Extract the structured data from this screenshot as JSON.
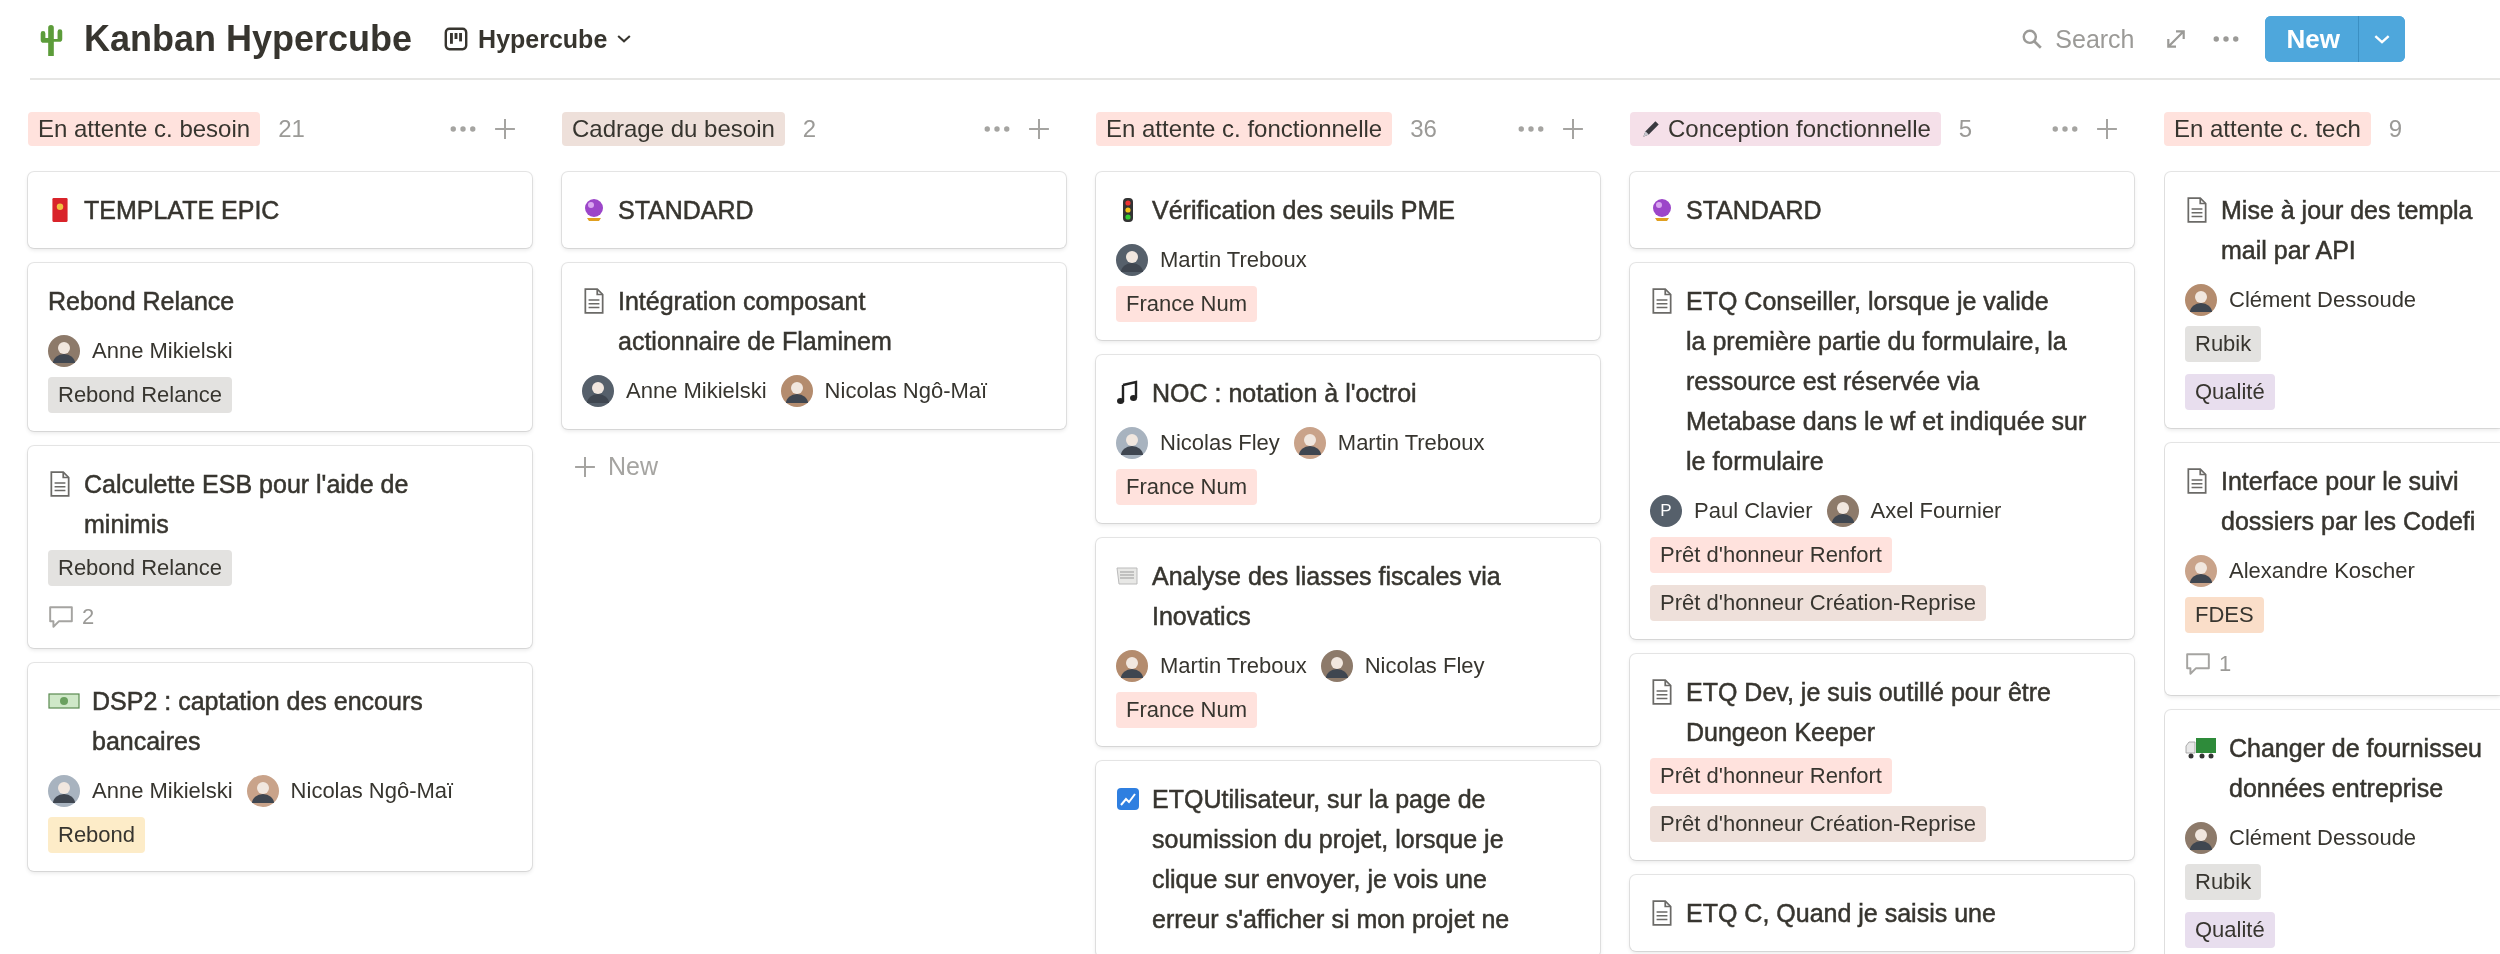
{
  "header": {
    "title": "Kanban Hypercube",
    "view": "Hypercube",
    "search": "Search",
    "new_button": "New"
  },
  "columns": [
    {
      "name": "En attente c. besoin",
      "color": "#ffe2dd",
      "count": "21",
      "actions": true,
      "cards": [
        {
          "title_lines": [
            "TEMPLATE EPIC"
          ]
        },
        {
          "title_lines": [
            "Rebond Relance"
          ],
          "people": [
            {
              "name": "Anne Mikielski"
            }
          ],
          "tags": [
            {
              "label": "Rebond Relance",
              "color": "#e3e2e0"
            }
          ]
        },
        {
          "title_lines": [
            "Calculette ESB pour l'aide de",
            "minimis"
          ],
          "tags": [
            {
              "label": "Rebond Relance",
              "color": "#e3e2e0"
            }
          ],
          "comments": "2"
        },
        {
          "title_lines": [
            "DSP2 : captation des encours",
            "bancaires"
          ],
          "people": [
            {
              "name": "Anne Mikielski"
            },
            {
              "name": "Nicolas Ngô-Maï"
            }
          ],
          "tags": [
            {
              "label": "Rebond",
              "color": "#fdecc8"
            }
          ]
        }
      ]
    },
    {
      "name": "Cadrage du besoin",
      "color": "#eee0da",
      "count": "2",
      "actions": true,
      "new_label": "New",
      "cards": [
        {
          "title_lines": [
            "STANDARD"
          ]
        },
        {
          "title_lines": [
            "Intégration composant",
            "actionnaire de Flaminem"
          ],
          "people": [
            {
              "name": "Anne Mikielski"
            },
            {
              "name": "Nicolas Ngô-Maï"
            }
          ]
        }
      ]
    },
    {
      "name": "En attente c. fonctionnelle",
      "color": "#ffe2dd",
      "count": "36",
      "actions": true,
      "cards": [
        {
          "title_lines": [
            "Vérification des seuils PME"
          ],
          "people": [
            {
              "name": "Martin Treboux"
            }
          ],
          "tags": [
            {
              "label": "France Num",
              "color": "#ffe2dd"
            }
          ]
        },
        {
          "title_lines": [
            "NOC : notation à l'octroi"
          ],
          "people": [
            {
              "name": "Nicolas Fley"
            },
            {
              "name": "Martin Treboux"
            }
          ],
          "tags": [
            {
              "label": "France Num",
              "color": "#ffe2dd"
            }
          ]
        },
        {
          "title_lines": [
            "Analyse des liasses fiscales via",
            "Inovatics"
          ],
          "people": [
            {
              "name": "Martin Treboux"
            },
            {
              "name": "Nicolas Fley"
            }
          ],
          "tags": [
            {
              "label": "France Num",
              "color": "#ffe2dd"
            }
          ]
        },
        {
          "title_lines": [
            "ETQUtilisateur, sur la page de",
            "soumission du projet, lorsque je",
            "clique sur envoyer, je vois une",
            "erreur s'afficher si mon projet ne"
          ]
        }
      ]
    },
    {
      "name": "Conception fonctionnelle",
      "color": "#f5e0e9",
      "count": "5",
      "actions": true,
      "cards": [
        {
          "title_lines": [
            "STANDARD"
          ]
        },
        {
          "title_lines": [
            "ETQ Conseiller, lorsque je valide",
            "la première partie du formulaire, la",
            "ressource est réservée via",
            "Metabase dans le wf et indiquée sur",
            "le formulaire"
          ],
          "people": [
            {
              "name": "Paul Clavier",
              "initial": "P"
            },
            {
              "name": "Axel Fournier"
            }
          ],
          "tags": [
            {
              "label": "Prêt d'honneur Renfort",
              "color": "#ffe2dd"
            },
            {
              "label": "Prêt d'honneur Création-Reprise",
              "color": "#eee0da"
            }
          ]
        },
        {
          "title_lines": [
            "ETQ Dev, je suis outillé pour être",
            "Dungeon Keeper"
          ],
          "tags": [
            {
              "label": "Prêt d'honneur Renfort",
              "color": "#ffe2dd"
            },
            {
              "label": "Prêt d'honneur Création-Reprise",
              "color": "#eee0da"
            }
          ]
        },
        {
          "title_lines": [
            "ETQ C, Quand je saisis une"
          ]
        }
      ]
    },
    {
      "name": "En attente c. tech",
      "color": "#ffe2dd",
      "count": "9",
      "actions": false,
      "cards": [
        {
          "title_lines": [
            "Mise à jour des templa",
            "mail par API"
          ],
          "people": [
            {
              "name": "Clément Dessoude"
            }
          ],
          "tags": [
            {
              "label": "Rubik",
              "color": "#e3e2e0"
            },
            {
              "label": "Qualité",
              "color": "#e8deee"
            }
          ]
        },
        {
          "title_lines": [
            "Interface pour le suivi",
            "dossiers par les Codefi"
          ],
          "people": [
            {
              "name": "Alexandre Koscher"
            }
          ],
          "tags": [
            {
              "label": "FDES",
              "color": "#fadec9"
            }
          ],
          "comments": "1"
        },
        {
          "title_lines": [
            "Changer de fournisseu",
            "données entreprise"
          ],
          "people": [
            {
              "name": "Clément Dessoude"
            }
          ],
          "tags": [
            {
              "label": "Rubik",
              "color": "#e3e2e0"
            },
            {
              "label": "Qualité",
              "color": "#e8deee"
            }
          ]
        }
      ]
    }
  ]
}
